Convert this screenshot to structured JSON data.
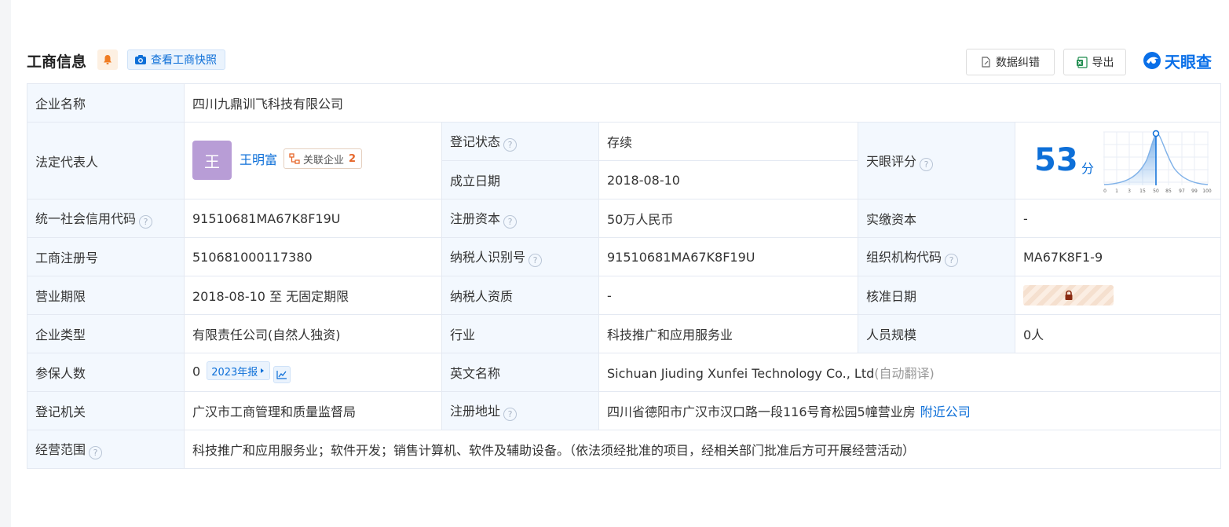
{
  "header": {
    "title": "工商信息",
    "snapshot_label": "查看工商快照",
    "fix_label": "数据纠错",
    "export_label": "导出",
    "brand": "天眼查"
  },
  "colors": {
    "accent": "#0d6fd8",
    "label_bg": "#f3f8fe",
    "status_green": "#2aa657",
    "avatar": "#b89dd6"
  },
  "icons": [
    "bell-icon",
    "camera-icon",
    "document-edit-icon",
    "excel-icon",
    "tianyancha-logo-icon",
    "help-circle-icon",
    "link-tree-icon",
    "trend-chart-icon",
    "lock-icon"
  ],
  "company": {
    "name_label": "企业名称",
    "name": "四川九鼎训飞科技有限公司",
    "rep_label": "法定代表人",
    "rep_avatar": "王",
    "rep_name": "王明富",
    "rel_label": "关联企业",
    "rel_count": "2",
    "status_label": "登记状态",
    "status": "存续",
    "est_label": "成立日期",
    "est": "2018-08-10",
    "score_label": "天眼评分",
    "score": "53",
    "score_unit": "分",
    "score_ticks": [
      "0",
      "1",
      "3",
      "15",
      "50",
      "85",
      "97",
      "99",
      "100"
    ],
    "credit_label": "统一社会信用代码",
    "credit": "91510681MA67K8F19U",
    "capital_label": "注册资本",
    "capital": "50万人民币",
    "paid_label": "实缴资本",
    "paid": "-",
    "reg_no_label": "工商注册号",
    "reg_no": "510681000117380",
    "tax_id_label": "纳税人识别号",
    "tax_id": "91510681MA67K8F19U",
    "org_label": "组织机构代码",
    "org": "MA67K8F1-9",
    "term_label": "营业期限",
    "term": "2018-08-10 至 无固定期限",
    "tax_qual_label": "纳税人资质",
    "tax_qual": "-",
    "approve_label": "核准日期",
    "type_label": "企业类型",
    "type": "有限责任公司(自然人独资)",
    "industry_label": "行业",
    "industry": "科技推广和应用服务业",
    "staff_label": "人员规模",
    "staff": "0人",
    "insured_label": "参保人数",
    "insured": "0",
    "report_label": "2023年报",
    "en_label": "英文名称",
    "en": "Sichuan Jiuding Xunfei Technology Co., Ltd",
    "en_note": "(自动翻译)",
    "authority_label": "登记机关",
    "authority": "广汉市工商管理和质量监督局",
    "addr_label": "注册地址",
    "addr": "四川省德阳市广汉市汉口路一段116号育松园5幢营业房",
    "nearby_label": "附近公司",
    "scope_label": "经营范围",
    "scope": "科技推广和应用服务业；软件开发；销售计算机、软件及辅助设备。（依法须经批准的项目，经相关部门批准后方可开展经营活动）"
  }
}
